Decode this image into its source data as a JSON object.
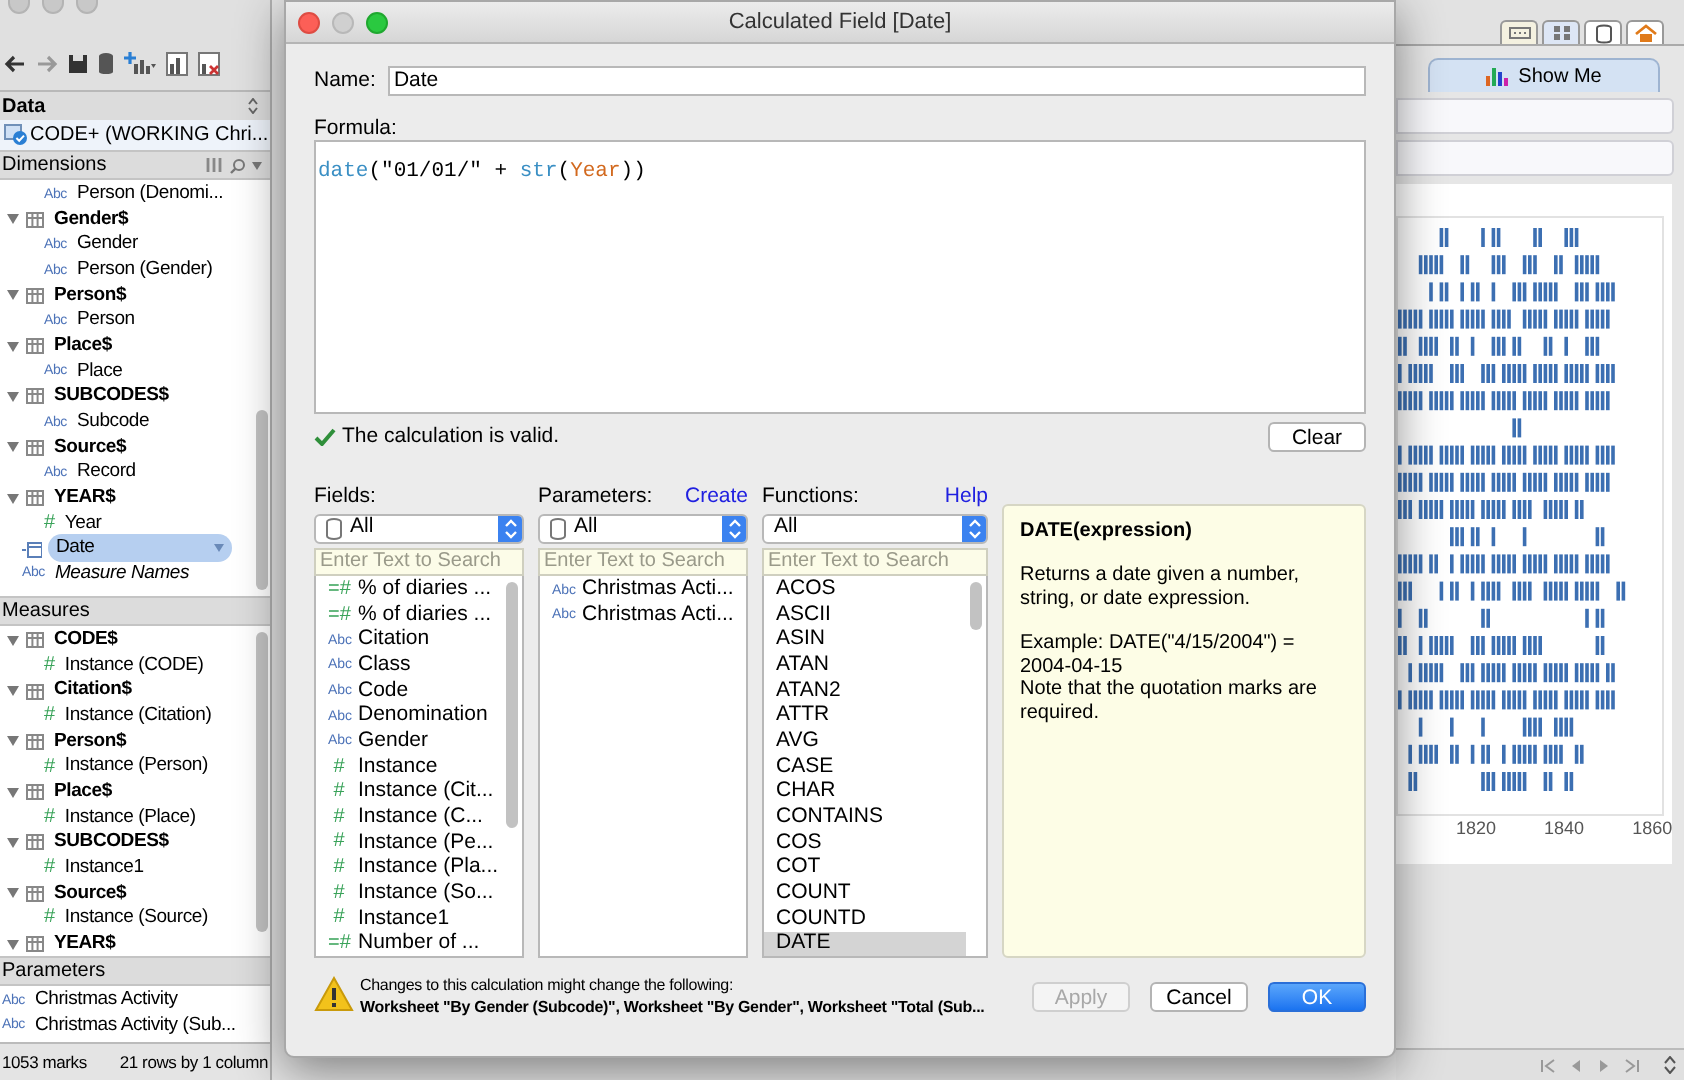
{
  "left_panel": {
    "data_header": "Data",
    "datasource": "CODE+ (WORKING Chri...",
    "dimensions": {
      "title": "Dimensions",
      "items": [
        {
          "kind": "dimension",
          "icon": "Abc",
          "label": "Person (Denomi...",
          "selected": false
        },
        {
          "kind": "table",
          "label": "Gender$",
          "expanded": true,
          "selected": false,
          "children": [
            {
              "kind": "dimension",
              "icon": "Abc",
              "label": "Gender",
              "selected": false
            },
            {
              "kind": "dimension",
              "icon": "Abc",
              "label": "Person (Gender)",
              "selected": false
            }
          ]
        },
        {
          "kind": "table",
          "label": "Person$",
          "expanded": true,
          "selected": false,
          "children": [
            {
              "kind": "dimension",
              "icon": "Abc",
              "label": "Person",
              "selected": false
            }
          ]
        },
        {
          "kind": "table",
          "label": "Place$",
          "expanded": true,
          "selected": false,
          "children": [
            {
              "kind": "dimension",
              "icon": "Abc",
              "label": "Place",
              "selected": false
            }
          ]
        },
        {
          "kind": "table",
          "label": "SUBCODES$",
          "expanded": true,
          "selected": false,
          "children": [
            {
              "kind": "dimension",
              "icon": "Abc",
              "label": "Subcode",
              "selected": false
            }
          ]
        },
        {
          "kind": "table",
          "label": "Source$",
          "expanded": true,
          "selected": false,
          "children": [
            {
              "kind": "dimension",
              "icon": "Abc",
              "label": "Record",
              "selected": false
            }
          ]
        },
        {
          "kind": "table",
          "label": "YEAR$",
          "expanded": true,
          "selected": false,
          "children": [
            {
              "kind": "measure",
              "icon": "#",
              "label": "Year",
              "selected": false
            }
          ]
        },
        {
          "kind": "date",
          "label": "Date",
          "selected": true
        },
        {
          "kind": "names",
          "icon": "Abc",
          "label": "Measure Names",
          "selected": false
        }
      ]
    },
    "measures": {
      "title": "Measures",
      "items": [
        {
          "kind": "table",
          "label": "CODE$",
          "expanded": true,
          "selected": false,
          "children": [
            {
              "kind": "measure",
              "icon": "#",
              "label": "Instance (CODE)",
              "selected": false
            }
          ]
        },
        {
          "kind": "table",
          "label": "Citation$",
          "expanded": true,
          "selected": false,
          "children": [
            {
              "kind": "measure",
              "icon": "#",
              "label": "Instance (Citation)",
              "selected": false
            }
          ]
        },
        {
          "kind": "table",
          "label": "Person$",
          "expanded": true,
          "selected": false,
          "children": [
            {
              "kind": "measure",
              "icon": "#",
              "label": "Instance (Person)",
              "selected": false
            }
          ]
        },
        {
          "kind": "table",
          "label": "Place$",
          "expanded": true,
          "selected": false,
          "children": [
            {
              "kind": "measure",
              "icon": "#",
              "label": "Instance (Place)",
              "selected": false
            }
          ]
        },
        {
          "kind": "table",
          "label": "SUBCODES$",
          "expanded": true,
          "selected": false,
          "children": [
            {
              "kind": "measure",
              "icon": "#",
              "label": "Instance1",
              "selected": false
            }
          ]
        },
        {
          "kind": "table",
          "label": "Source$",
          "expanded": true,
          "selected": false,
          "children": [
            {
              "kind": "measure",
              "icon": "#",
              "label": "Instance (Source)",
              "selected": false
            }
          ]
        },
        {
          "kind": "table",
          "label": "YEAR$",
          "expanded": true,
          "selected": false
        }
      ]
    },
    "parameters": {
      "title": "Parameters",
      "items": [
        {
          "kind": "dimension",
          "icon": "Abc",
          "label": "Christmas Activity",
          "selected": false
        },
        {
          "kind": "dimension",
          "icon": "Abc",
          "label": "Christmas Activity (Sub...",
          "selected": false
        }
      ]
    },
    "status": [
      "1053 marks",
      "21 rows by 1 column"
    ]
  },
  "dialog": {
    "title": "Calculated Field [Date]",
    "name_label": "Name:",
    "name_value": "Date",
    "formula_label": "Formula:",
    "formula": [
      {
        "kind": "function",
        "text": "date"
      },
      {
        "kind": "plain",
        "text": "(\"01/01/\" + "
      },
      {
        "kind": "function",
        "text": "str"
      },
      {
        "kind": "plain",
        "text": "("
      },
      {
        "kind": "field",
        "text": "Year"
      },
      {
        "kind": "plain",
        "text": "))"
      }
    ],
    "validation": "The calculation is valid.",
    "clear_button": "Clear",
    "fields": {
      "label": "Fields:",
      "dropdown": {
        "value": "All",
        "source_icon": true
      },
      "search_placeholder": "Enter Text to Search",
      "items": [
        {
          "kind": "calc_measure",
          "icon": "=#",
          "label": "% of diaries ..."
        },
        {
          "kind": "calc_measure",
          "icon": "=#",
          "label": "% of diaries ..."
        },
        {
          "kind": "dimension",
          "icon": "Abc",
          "label": "Citation"
        },
        {
          "kind": "dimension",
          "icon": "Abc",
          "label": "Class"
        },
        {
          "kind": "dimension",
          "icon": "Abc",
          "label": "Code"
        },
        {
          "kind": "dimension",
          "icon": "Abc",
          "label": "Denomination"
        },
        {
          "kind": "dimension",
          "icon": "Abc",
          "label": "Gender"
        },
        {
          "kind": "measure",
          "icon": "#",
          "label": "Instance"
        },
        {
          "kind": "measure",
          "icon": "#",
          "label": "Instance (Cit..."
        },
        {
          "kind": "measure",
          "icon": "#",
          "label": "Instance (C..."
        },
        {
          "kind": "measure",
          "icon": "#",
          "label": "Instance (Pe..."
        },
        {
          "kind": "measure",
          "icon": "#",
          "label": "Instance (Pla..."
        },
        {
          "kind": "measure",
          "icon": "#",
          "label": "Instance (So..."
        },
        {
          "kind": "measure",
          "icon": "#",
          "label": "Instance1"
        },
        {
          "kind": "calc_measure",
          "icon": "=#",
          "label": "Number of ..."
        }
      ]
    },
    "parameters": {
      "label": "Parameters:",
      "link": "Create",
      "dropdown": {
        "value": "All",
        "source_icon": true
      },
      "search_placeholder": "Enter Text to Search",
      "items": [
        {
          "kind": "dimension",
          "icon": "Abc",
          "label": "Christmas Acti..."
        },
        {
          "kind": "dimension",
          "icon": "Abc",
          "label": "Christmas Acti..."
        }
      ]
    },
    "functions": {
      "label": "Functions:",
      "link": "Help",
      "dropdown": {
        "value": "All",
        "source_icon": false
      },
      "search_placeholder": "Enter Text to Search",
      "items": [
        {
          "label": "ACOS",
          "selected": false
        },
        {
          "label": "ASCII",
          "selected": false
        },
        {
          "label": "ASIN",
          "selected": false
        },
        {
          "label": "ATAN",
          "selected": false
        },
        {
          "label": "ATAN2",
          "selected": false
        },
        {
          "label": "ATTR",
          "selected": false
        },
        {
          "label": "AVG",
          "selected": false
        },
        {
          "label": "CASE",
          "selected": false
        },
        {
          "label": "CHAR",
          "selected": false
        },
        {
          "label": "CONTAINS",
          "selected": false
        },
        {
          "label": "COS",
          "selected": false
        },
        {
          "label": "COT",
          "selected": false
        },
        {
          "label": "COUNT",
          "selected": false
        },
        {
          "label": "COUNTD",
          "selected": false
        },
        {
          "label": "DATE",
          "selected": true
        }
      ]
    },
    "help": {
      "title": "DATE(expression)",
      "paragraphs": [
        "Returns a date given a number, string, or date expression."
      ],
      "example": [
        "Example: DATE(\"4/15/2004\") =",
        "2004-04-15",
        "Note that the quotation marks are required."
      ]
    },
    "warning": [
      "Changes to this calculation might change the following:",
      "Worksheet \"By Gender (Subcode)\", Worksheet \"By Gender\", Worksheet \"Total (Sub..."
    ],
    "buttons": [
      {
        "kind": "apply",
        "label": "Apply",
        "disabled": true
      },
      {
        "kind": "cancel",
        "label": "Cancel",
        "disabled": false
      },
      {
        "kind": "ok",
        "label": "OK",
        "disabled": false
      }
    ]
  },
  "right_panel": {
    "show_me": "Show Me",
    "axis_labels": [
      "1820",
      "1840",
      "1860"
    ]
  }
}
